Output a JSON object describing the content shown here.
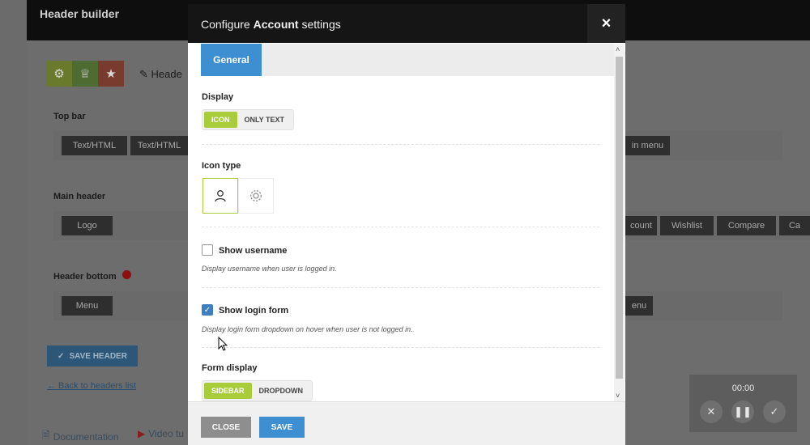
{
  "background": {
    "title": "Header builder",
    "header_label": "Heade",
    "sections": {
      "top_bar": "Top bar",
      "main_header": "Main header",
      "header_bottom": "Header bottom"
    },
    "buttons": {
      "texthtml_1": "Text/HTML",
      "texthtml_2": "Text/HTML",
      "main_menu_partial": "in menu",
      "logo": "Logo",
      "account_partial": "count",
      "wishlist": "Wishlist",
      "compare": "Compare",
      "cart_partial": "Ca",
      "menu": "Menu",
      "menu_partial": "enu"
    },
    "save_header": "SAVE HEADER",
    "back_link": "← Back to headers list",
    "documentation": "Documentation",
    "video": "Video tu"
  },
  "modal": {
    "title_prefix": "Configure ",
    "title_bold": "Account",
    "title_suffix": " settings",
    "close_icon": "×",
    "tabs": [
      {
        "label": "General",
        "active": true
      }
    ],
    "display": {
      "label": "Display",
      "options": [
        {
          "label": "ICON",
          "selected": true
        },
        {
          "label": "ONLY TEXT",
          "selected": false
        }
      ]
    },
    "icon_type": {
      "label": "Icon type",
      "options": [
        {
          "icon": "user-icon",
          "selected": true
        },
        {
          "icon": "gear-icon",
          "selected": false
        }
      ]
    },
    "show_username": {
      "label": "Show username",
      "checked": false,
      "hint": "Display username when user is logged in."
    },
    "show_login_form": {
      "label": "Show login form",
      "checked": true,
      "hint": "Display login form dropdown on hover when user is not logged in."
    },
    "form_display": {
      "label": "Form display",
      "options": [
        {
          "label": "SIDEBAR",
          "selected": true
        },
        {
          "label": "DROPDOWN",
          "selected": false
        }
      ]
    },
    "footer": {
      "close": "CLOSE",
      "save": "SAVE"
    }
  },
  "recorder": {
    "time": "00:00"
  },
  "colors": {
    "accent_green": "#a9cd3a",
    "accent_blue": "#3e8ed2",
    "modal_header": "#151515"
  }
}
